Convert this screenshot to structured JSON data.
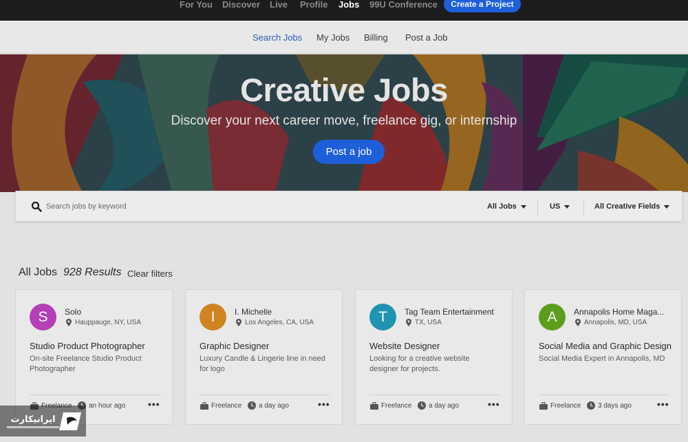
{
  "top_nav": {
    "items": [
      {
        "label": "For You",
        "active": false
      },
      {
        "label": "Discover",
        "active": false
      },
      {
        "label": "Live",
        "active": false
      },
      {
        "label": "Profile",
        "active": false
      },
      {
        "label": "Jobs",
        "active": true
      },
      {
        "label": "99U Conference",
        "active": false
      }
    ],
    "create_button": "Create a Project"
  },
  "sub_nav": {
    "items": [
      {
        "label": "Search Jobs",
        "active": true
      },
      {
        "label": "My Jobs",
        "active": false
      },
      {
        "label": "Billing",
        "active": false
      },
      {
        "label": "Post a Job",
        "active": false
      }
    ]
  },
  "hero": {
    "title": "Creative Jobs",
    "subtitle": "Discover your next career move, freelance gig, or internship",
    "button": "Post a job"
  },
  "search": {
    "placeholder": "Search jobs by keyword",
    "filters": {
      "job_type": "All Jobs",
      "country": "US",
      "field": "All Creative Fields"
    }
  },
  "results": {
    "heading": "All Jobs",
    "count": "928 Results",
    "clear": "Clear filters"
  },
  "jobs": [
    {
      "initial": "S",
      "avatar_color": "#b43fb8",
      "company": "Solo",
      "location": "Hauppauge, NY, USA",
      "title": "Studio Product Photographer",
      "description": "On-site Freelance Studio Product Photographer",
      "type": "Freelance",
      "posted": "an hour ago"
    },
    {
      "initial": "I",
      "avatar_color": "#d08321",
      "company": "I. Michelle",
      "location": "Los Angeles, CA, USA",
      "title": "Graphic Designer",
      "description": "Luxury Candle & Lingerie line in need for logo",
      "type": "Freelance",
      "posted": "a day ago"
    },
    {
      "initial": "T",
      "avatar_color": "#1e94b0",
      "company": "Tag Team Entertainment",
      "location": "TX, USA",
      "title": "Website Designer",
      "description": "Looking for a creative website designer for projects.",
      "type": "Freelance",
      "posted": "a day ago"
    },
    {
      "initial": "A",
      "avatar_color": "#5b9e1c",
      "company": "Annapolis Home Maga...",
      "location": "Annapolis, MD, USA",
      "title": "Social Media and Graphic Design",
      "description": "Social Media Expert in Annapolis, MD",
      "type": "Freelance",
      "posted": "3 days ago"
    }
  ],
  "watermark": {
    "text": "ایرانیکارت"
  },
  "colors": {
    "accent": "#1d5fd8",
    "active_link": "#2a5eb8",
    "top_nav_bg": "#1c1c1c"
  }
}
